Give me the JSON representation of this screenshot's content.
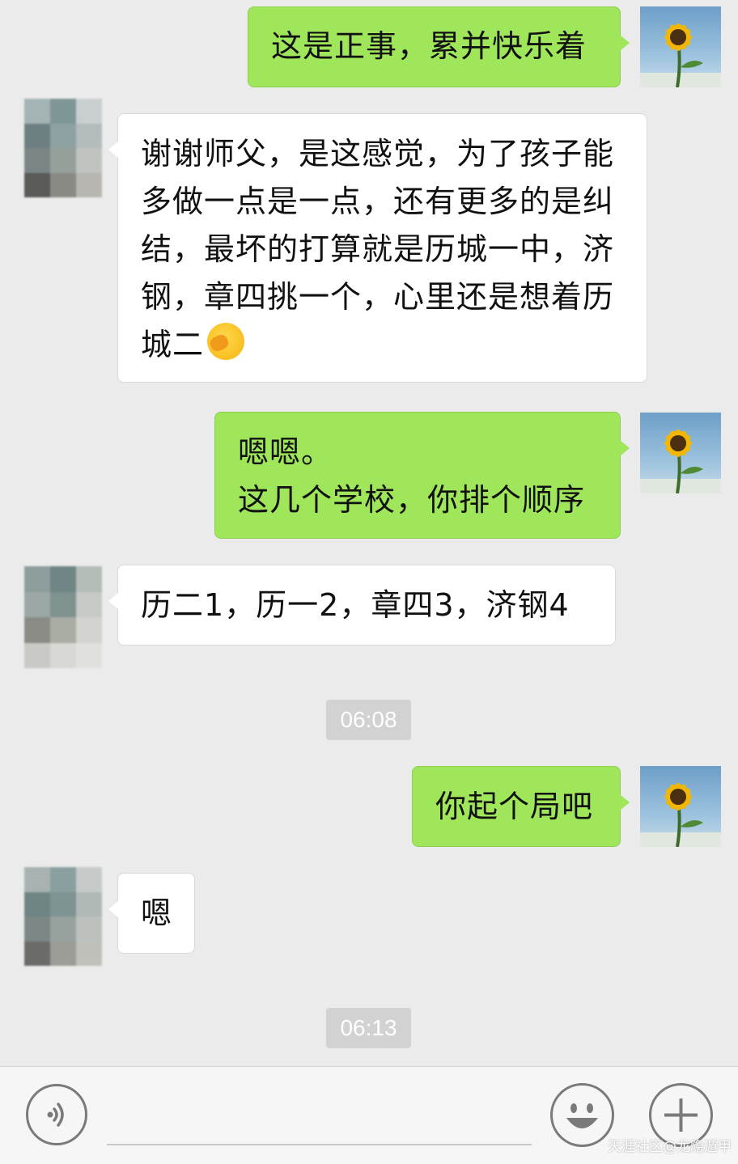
{
  "messages": [
    {
      "side": "self",
      "text": "这是正事，累并快乐着"
    },
    {
      "side": "other",
      "lines": [
        "谢谢师父，是这感觉，为了孩子能",
        "多做一点是一点，还有更多的是纠",
        "结，最坏的打算就是历城一中，济",
        "钢，章四挑一个，心里还是想着历",
        "城二"
      ],
      "emoji": "facepalm-emoji"
    },
    {
      "side": "self",
      "lines": [
        "嗯嗯。",
        "这几个学校，你排个顺序"
      ]
    },
    {
      "side": "other",
      "text": "历二1，历一2，章四3，济钢4"
    },
    {
      "side": "time",
      "text": "06:08"
    },
    {
      "side": "self",
      "text": "你起个局吧"
    },
    {
      "side": "other",
      "text": "嗯"
    },
    {
      "side": "time",
      "text": "06:13"
    }
  ],
  "toolbar": {
    "voice_icon": "voice-icon",
    "emoji_icon": "smiley-icon",
    "plus_icon": "plus-icon"
  },
  "watermark": "天涯社区@龙隐遁甲",
  "colors": {
    "self_bubble": "#9fe65a",
    "other_bubble": "#ffffff",
    "background": "#ebebeb"
  }
}
